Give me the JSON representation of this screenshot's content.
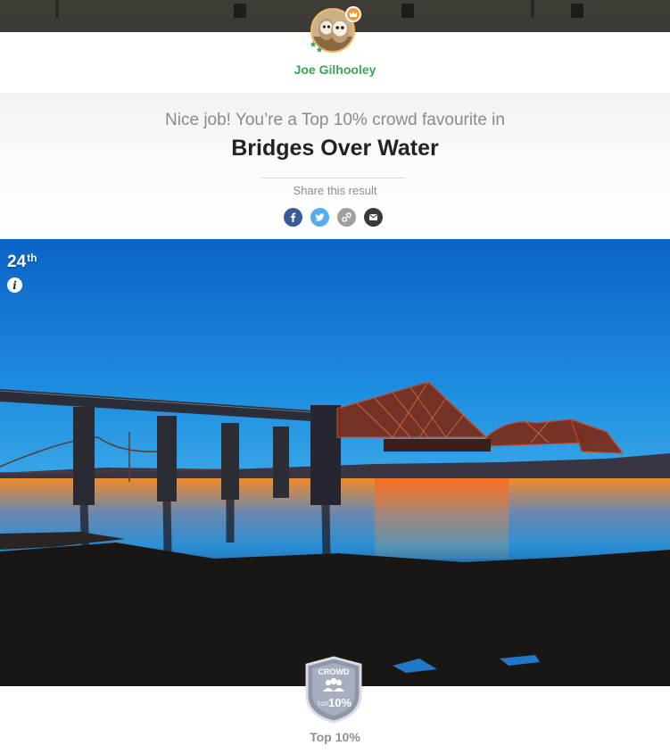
{
  "user": {
    "name": "Joe Gilhooley"
  },
  "result": {
    "headline": "Nice job! You’re a Top 10% crowd favourite in",
    "category": "Bridges Over Water",
    "share_label": "Share this result"
  },
  "share": [
    {
      "name": "facebook-icon",
      "glyph": "f",
      "color": "#3b5998"
    },
    {
      "name": "twitter-icon",
      "glyph": "t",
      "color": "#55acee"
    },
    {
      "name": "link-icon",
      "glyph": "link",
      "color": "#9e9e9e"
    },
    {
      "name": "email-icon",
      "glyph": "mail",
      "color": "#3a3a3a"
    }
  ],
  "photo": {
    "rank_number": "24",
    "rank_suffix": "th",
    "info_glyph": "i"
  },
  "badge": {
    "top_text": "CROWD",
    "small_text": "TOP",
    "big_text": "10%",
    "label": "Top 10%"
  },
  "colors": {
    "accent_green": "#3aa655",
    "crown_orange": "#f29b3c"
  }
}
